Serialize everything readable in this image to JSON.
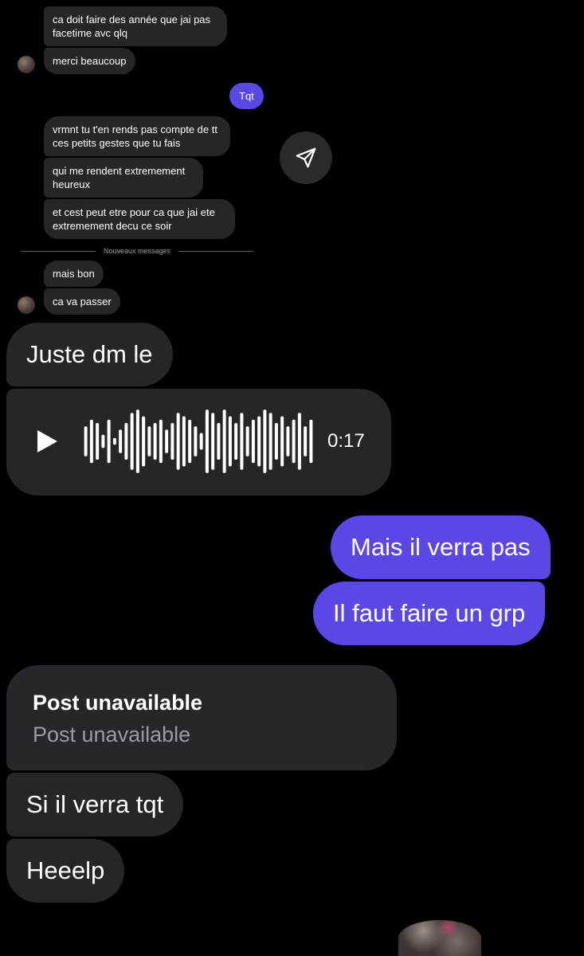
{
  "messages_top": [
    {
      "text": "ca doit faire des année que jai pas facetime avc qlq"
    },
    {
      "text": "merci beaucoup"
    }
  ],
  "outgoing_small": {
    "text": "Tqt"
  },
  "messages_mid": [
    {
      "text": "vrmnt tu t'en rends pas compte de tt ces petits gestes que tu fais"
    },
    {
      "text": "qui me rendent extremement heureux"
    },
    {
      "text": "et cest peut etre pour ca que jai ete extremement decu ce soir"
    }
  ],
  "divider": {
    "label": "Nouveaux messages"
  },
  "messages_after": [
    {
      "text": "mais bon"
    },
    {
      "text": "ca va passer"
    }
  ],
  "big_in_1": {
    "text": "Juste dm le"
  },
  "voice_message": {
    "duration": "0:17",
    "bar_levels": [
      0.45,
      0.65,
      0.55,
      0.2,
      0.65,
      0.1,
      0.35,
      0.55,
      0.85,
      0.95,
      0.75,
      0.45,
      0.55,
      0.65,
      0.35,
      0.55,
      0.85,
      0.75,
      0.65,
      0.45,
      0.25,
      0.95,
      0.85,
      0.55,
      0.95,
      0.75,
      0.55,
      0.85,
      0.45,
      0.65,
      0.75,
      0.95,
      0.85,
      0.55,
      0.75,
      0.45,
      0.65,
      0.85,
      0.45,
      0.65
    ]
  },
  "big_out": [
    {
      "text": "Mais il verra pas"
    },
    {
      "text": "Il faut faire un grp"
    }
  ],
  "post_card": {
    "title": "Post unavailable",
    "subtitle": "Post unavailable"
  },
  "big_in_2": [
    {
      "text": "Si il verra tqt"
    },
    {
      "text": "Heeelp"
    }
  ],
  "icons": {
    "share": "send-icon",
    "play": "play-icon"
  },
  "colors": {
    "outgoing": "#5b47e6",
    "incoming": "#262626",
    "background": "#000000"
  }
}
